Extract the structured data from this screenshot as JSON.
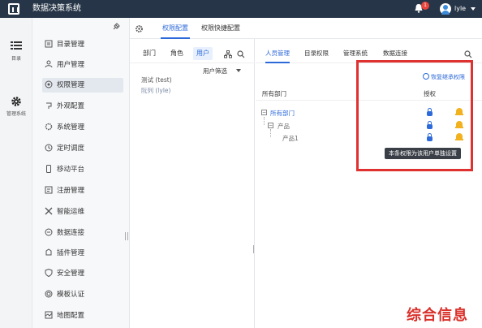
{
  "header": {
    "app_title": "数据决策系统",
    "notification_count": "1",
    "username": "lyle"
  },
  "rail": [
    {
      "icon": "list-icon",
      "label": "目录"
    },
    {
      "icon": "gear-icon",
      "label": "管理系统"
    }
  ],
  "menu": [
    {
      "label": "目录管理",
      "icon": "folder-icon"
    },
    {
      "label": "用户管理",
      "icon": "user-icon"
    },
    {
      "label": "权限管理",
      "icon": "shield-icon",
      "active": true
    },
    {
      "label": "外观配置",
      "icon": "palette-icon"
    },
    {
      "label": "系统管理",
      "icon": "system-icon"
    },
    {
      "label": "定时调度",
      "icon": "clock-icon"
    },
    {
      "label": "移动平台",
      "icon": "mobile-icon"
    },
    {
      "label": "注册管理",
      "icon": "register-icon"
    },
    {
      "label": "智能运维",
      "icon": "ops-icon"
    },
    {
      "label": "数据连接",
      "icon": "link-icon"
    },
    {
      "label": "插件管理",
      "icon": "plugin-icon"
    },
    {
      "label": "安全管理",
      "icon": "security-icon"
    },
    {
      "label": "模板认证",
      "icon": "certificate-icon"
    },
    {
      "label": "地图配置",
      "icon": "map-icon"
    }
  ],
  "tabs": [
    "权限配置",
    "权限快捷配置"
  ],
  "subject": {
    "tabs": [
      "部门",
      "角色",
      "用户"
    ],
    "filter_label": "用户筛选",
    "users": [
      "测试 (test)",
      "阮列 (lyle)"
    ]
  },
  "right": {
    "tabs": [
      "人员管理",
      "目录权限",
      "管理系统",
      "数据连接"
    ],
    "restore_label": "恢复继承权限",
    "col_dept": "所有部门",
    "col_grant": "授权",
    "tree": [
      "所有部门",
      "产品",
      "产品1"
    ],
    "tooltip": "本条权限为该用户单独设置"
  },
  "watermark": "综合信息"
}
